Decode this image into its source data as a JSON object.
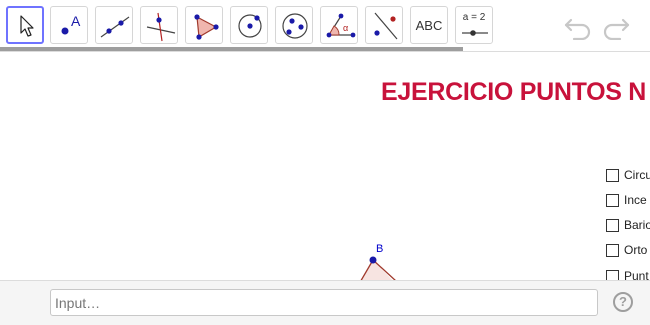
{
  "toolbar": {
    "tools": [
      {
        "name": "move-tool",
        "active": true
      },
      {
        "name": "point-tool",
        "icon_label": "A"
      },
      {
        "name": "line-tool"
      },
      {
        "name": "perpendicular-line-tool"
      },
      {
        "name": "polygon-tool"
      },
      {
        "name": "circle-center-point-tool"
      },
      {
        "name": "conic-tool"
      },
      {
        "name": "angle-tool",
        "icon_label": "α"
      },
      {
        "name": "reflect-tool"
      },
      {
        "name": "text-tool",
        "label": "ABC"
      },
      {
        "name": "slider-tool",
        "label": "a = 2"
      }
    ],
    "undo_icon": "undo-icon",
    "redo_icon": "redo-icon"
  },
  "canvas": {
    "title": "EJERCICIO PUNTOS N",
    "checkboxes": [
      {
        "label": "Circu",
        "checked": false
      },
      {
        "label": "Ince",
        "checked": false
      },
      {
        "label": "Bario",
        "checked": false
      },
      {
        "label": "Orto",
        "checked": false
      },
      {
        "label": "Punt",
        "checked": false
      }
    ],
    "point_label": "B"
  },
  "input_bar": {
    "placeholder": "Input…",
    "value": ""
  },
  "colors": {
    "title": "#c8123b",
    "point": "#1a1aa8",
    "active_tool_border": "#6f73ff",
    "triangle_stroke": "#a0392c"
  }
}
